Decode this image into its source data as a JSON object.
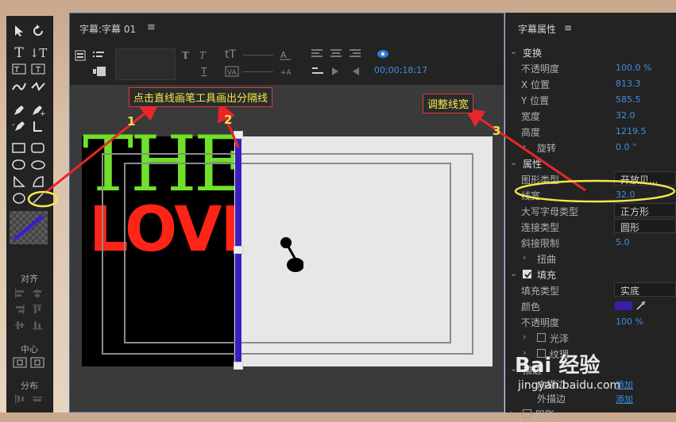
{
  "title_window": {
    "title": "字幕:字幕 01",
    "menu_icon": "≡",
    "timecode": "00;00;18;17"
  },
  "tools_panel": {
    "sections": {
      "align": "对齐",
      "center": "中心",
      "distribute": "分布"
    },
    "tools": [
      "selection-tool",
      "rotation-tool",
      "type-tool",
      "vertical-type-tool",
      "area-type-tool",
      "vertical-area-type-tool",
      "path-type-tool",
      "vertical-path-type-tool",
      "pen-tool",
      "add-anchor-tool",
      "delete-anchor-tool",
      "convert-anchor-tool",
      "rectangle-tool",
      "rounded-rectangle-tool",
      "ellipse-tool",
      "rounded-corner-rectangle-tool",
      "wedge-tool",
      "arc-tool",
      "circle-tool",
      "line-tool"
    ]
  },
  "callouts": {
    "c1": "点击直线画笔工具画出分隔线",
    "c3": "调整线宽",
    "n1": "1",
    "n2": "2",
    "n3": "3"
  },
  "canvas": {
    "text_top": "THE",
    "text_bottom": "LOVE"
  },
  "properties": {
    "header": "字幕属性",
    "menu_icon": "≡",
    "transform": {
      "label": "变换",
      "opacity_label": "不透明度",
      "opacity": "100.0 %",
      "x_label": "X 位置",
      "x": "813.3",
      "y_label": "Y 位置",
      "y": "585.5",
      "width_label": "宽度",
      "width": "32.0",
      "height_label": "高度",
      "height": "1219.5",
      "rotation_label": "旋转",
      "rotation": "0.0 °"
    },
    "attributes": {
      "label": "属性",
      "graphic_type_label": "图形类型",
      "graphic_type": "开放贝...",
      "line_width_label": "线宽",
      "line_width": "32.0",
      "cap_type_label": "大写字母类型",
      "cap_type": "正方形",
      "join_type_label": "连接类型",
      "join_type": "圆形",
      "miter_limit_label": "斜接限制",
      "miter_limit": "5.0",
      "distort_label": "扭曲"
    },
    "fill": {
      "label": "填充",
      "fill_type_label": "填充类型",
      "fill_type": "实底",
      "color_label": "颜色",
      "color": "#3a1fa8",
      "opacity_label": "不透明度",
      "opacity": "100 %",
      "sheen_label": "光泽",
      "texture_label": "纹理"
    },
    "strokes": {
      "label": "描边",
      "inner_label": "内描边",
      "inner_action": "添加",
      "outer_label": "外描边",
      "outer_action": "添加"
    },
    "shadow": {
      "label": "阴影"
    }
  },
  "watermark": {
    "logo": "Bai 经验",
    "url": "jingyan.baidu.com"
  }
}
